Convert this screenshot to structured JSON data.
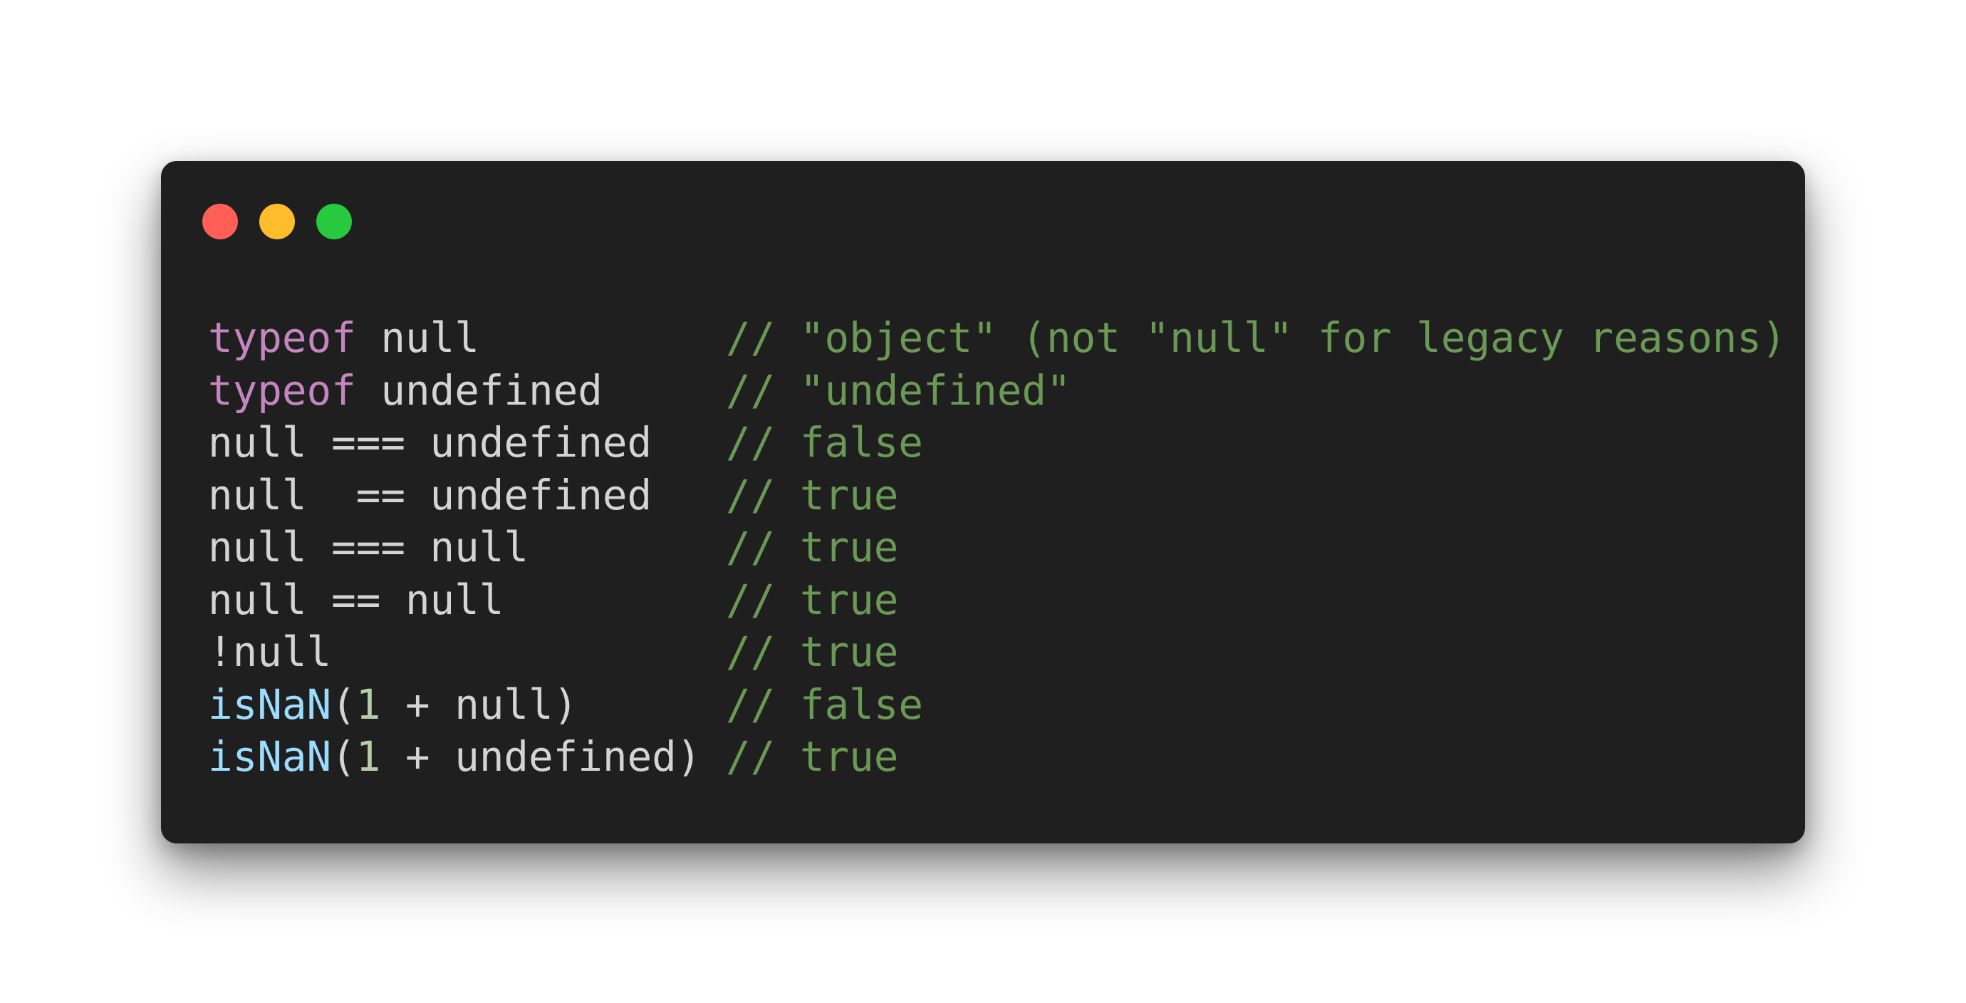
{
  "window_controls": {
    "close": "close",
    "minimize": "minimize",
    "maximize": "maximize",
    "colors": {
      "close": "#ff5f56",
      "minimize": "#ffbd2e",
      "maximize": "#27c93f"
    }
  },
  "theme": {
    "background": "#1f1f1f",
    "text": "#d4d4d4",
    "keyword": "#c586c0",
    "function": "#9cdcfe",
    "number": "#b5cea8",
    "comment": "#6a9955"
  },
  "code": {
    "lines": [
      {
        "tokens": [
          {
            "t": "kw",
            "v": "typeof"
          },
          {
            "t": "tx",
            "v": " null          "
          },
          {
            "t": "cm",
            "v": "// \"object\" (not \"null\" for legacy reasons)"
          }
        ]
      },
      {
        "tokens": [
          {
            "t": "kw",
            "v": "typeof"
          },
          {
            "t": "tx",
            "v": " undefined     "
          },
          {
            "t": "cm",
            "v": "// \"undefined\""
          }
        ]
      },
      {
        "tokens": [
          {
            "t": "tx",
            "v": "null === undefined   "
          },
          {
            "t": "cm",
            "v": "// false"
          }
        ]
      },
      {
        "tokens": [
          {
            "t": "tx",
            "v": "null  == undefined   "
          },
          {
            "t": "cm",
            "v": "// true"
          }
        ]
      },
      {
        "tokens": [
          {
            "t": "tx",
            "v": "null === null        "
          },
          {
            "t": "cm",
            "v": "// true"
          }
        ]
      },
      {
        "tokens": [
          {
            "t": "tx",
            "v": "null == null         "
          },
          {
            "t": "cm",
            "v": "// true"
          }
        ]
      },
      {
        "tokens": [
          {
            "t": "tx",
            "v": "!null                "
          },
          {
            "t": "cm",
            "v": "// true"
          }
        ]
      },
      {
        "tokens": [
          {
            "t": "fn",
            "v": "isNaN"
          },
          {
            "t": "tx",
            "v": "("
          },
          {
            "t": "num",
            "v": "1"
          },
          {
            "t": "tx",
            "v": " + null)      "
          },
          {
            "t": "cm",
            "v": "// false"
          }
        ]
      },
      {
        "tokens": [
          {
            "t": "fn",
            "v": "isNaN"
          },
          {
            "t": "tx",
            "v": "("
          },
          {
            "t": "num",
            "v": "1"
          },
          {
            "t": "tx",
            "v": " + undefined) "
          },
          {
            "t": "cm",
            "v": "// true"
          }
        ]
      }
    ]
  }
}
